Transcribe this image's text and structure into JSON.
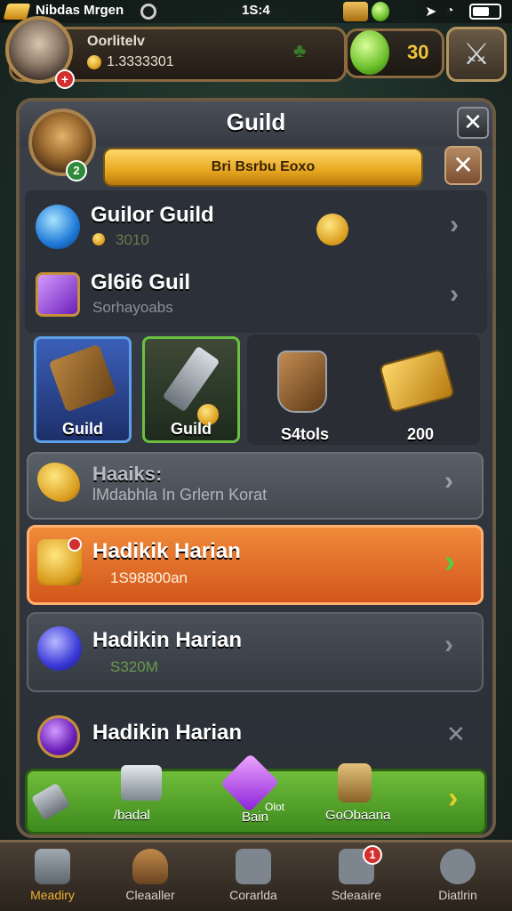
{
  "status_bar": {
    "left_name": "Nibdas Mrgen",
    "time": "1S:4"
  },
  "player": {
    "name": "Oorlitelv",
    "gold": "1.3333301",
    "badge": "+"
  },
  "currency": {
    "amount": "30"
  },
  "guild_panel": {
    "title": "Guild",
    "banner": "Bri Bsrbu Eoxo",
    "guild_badge": "2",
    "rows": [
      {
        "title": "Guilor Guild",
        "sub": "3010"
      },
      {
        "title": "Gl6i6 Guil",
        "sub": "Sorhayoabs"
      }
    ],
    "cards": [
      {
        "label": "Guild"
      },
      {
        "label": "Guild"
      },
      {
        "label": "S4tols"
      },
      {
        "label": "200"
      }
    ],
    "bars": [
      {
        "title": "Haaiks:",
        "sub": "lMdabhla In Grlern Korat"
      },
      {
        "title": "Hadikik Harian",
        "sub": "1S98800an"
      },
      {
        "title": "Hadikin Harian",
        "sub": "S320M"
      },
      {
        "title": "Hadikin Harian",
        "sub": ""
      }
    ],
    "bottom_strip": [
      {
        "label": "/badal"
      },
      {
        "label": "Bain"
      },
      {
        "label": "GoObaana"
      }
    ],
    "bottom_strip_small": "Olot"
  },
  "nav": [
    {
      "label": "Meadiry",
      "badge": ""
    },
    {
      "label": "Cleaaller",
      "badge": ""
    },
    {
      "label": "Corarlda",
      "badge": ""
    },
    {
      "label": "Sdeaaire",
      "badge": "1"
    },
    {
      "label": "Diatlrin",
      "badge": ""
    }
  ],
  "colors": {
    "orange_bar": "#e36a1f",
    "green_strip": "#5aa830",
    "panel": "#343941"
  }
}
